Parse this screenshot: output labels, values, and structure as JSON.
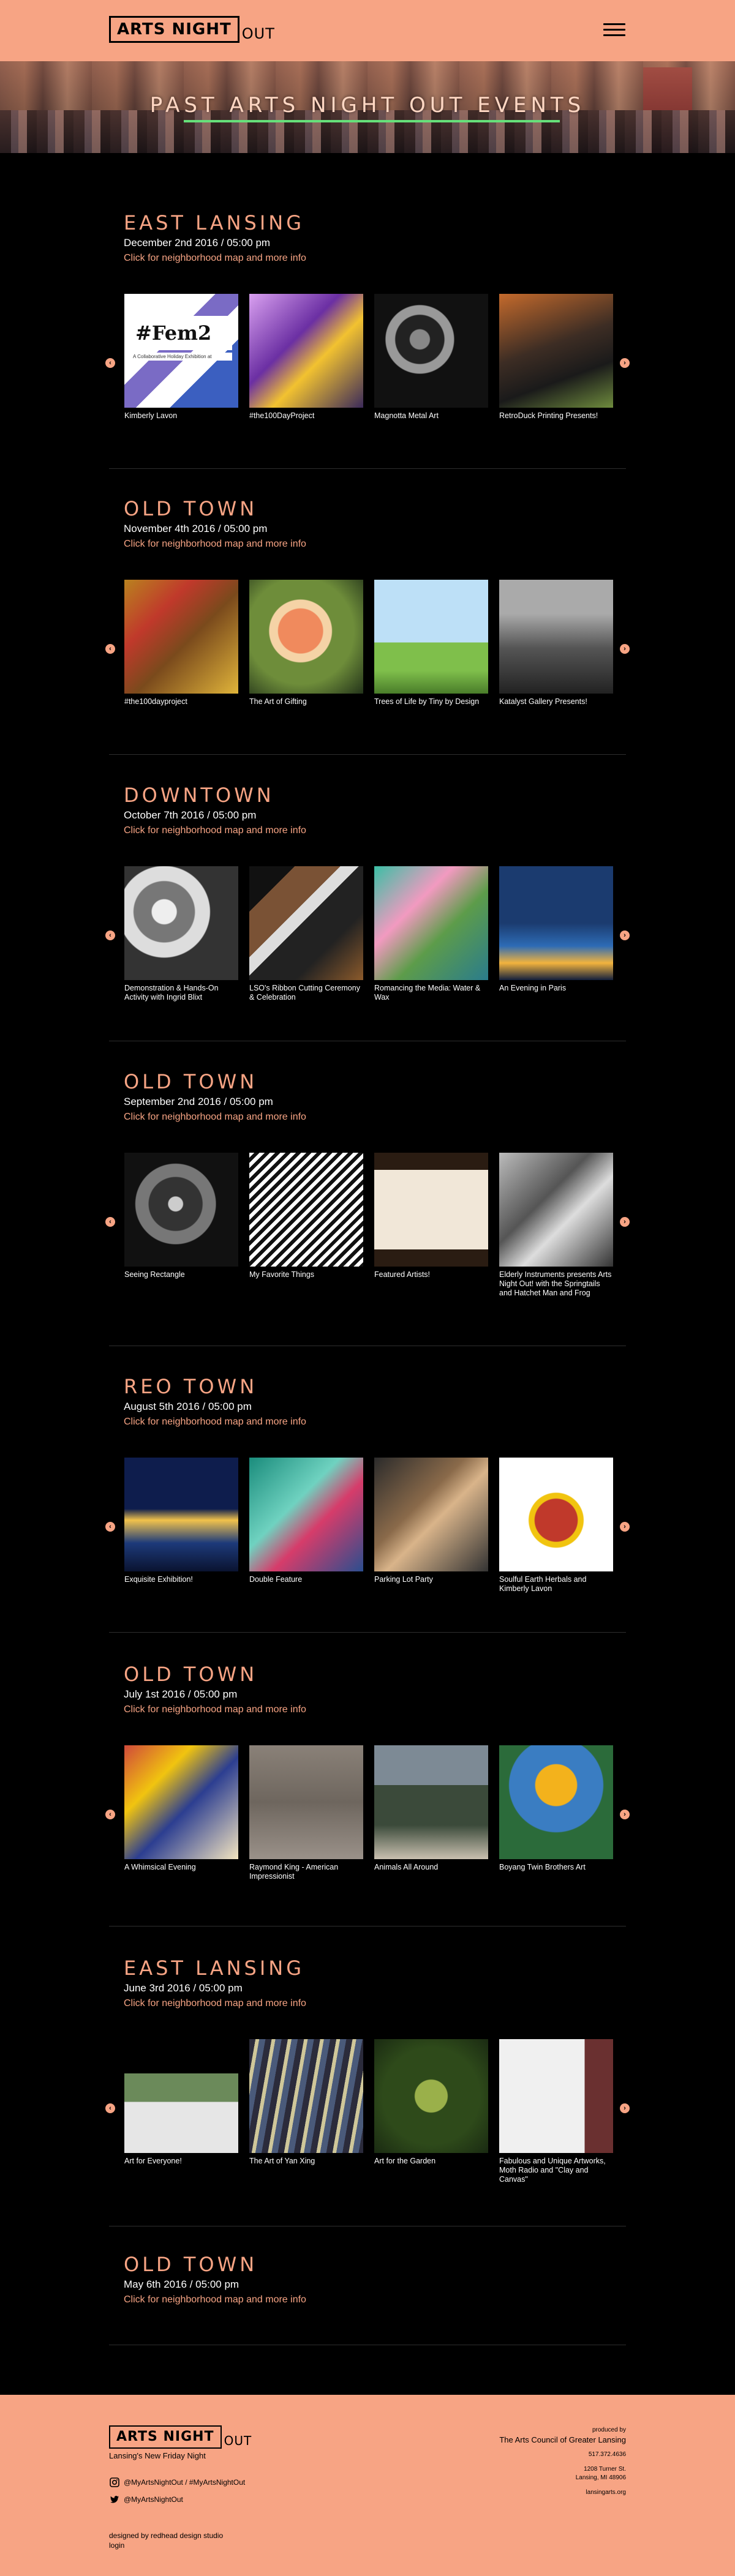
{
  "header": {
    "logo_main": "ARTS NIGHT",
    "logo_out": "OUT",
    "menu_icon": "hamburger-menu-icon"
  },
  "banner": {
    "title": "PAST ARTS NIGHT OUT EVENTS"
  },
  "events": [
    {
      "neighborhood": "EAST LANSING",
      "date": "December 2nd 2016 / 05:00 pm",
      "link": "Click for neighborhood map and more info",
      "items": [
        "Kimberly Lavon",
        "#the100DayProject",
        "Magnotta Metal Art",
        "RetroDuck Printing Presents!"
      ]
    },
    {
      "neighborhood": "OLD TOWN",
      "date": "November 4th 2016 / 05:00 pm",
      "link": "Click for neighborhood map and more info",
      "items": [
        "#the100dayproject",
        "The Art of Gifting",
        "Trees of Life by Tiny by Design",
        "Katalyst Gallery Presents!"
      ]
    },
    {
      "neighborhood": "DOWNTOWN",
      "date": "October 7th 2016 / 05:00 pm",
      "link": "Click for neighborhood map and more info",
      "items": [
        "Demonstration & Hands-On Activity with Ingrid Blixt",
        "LSO's Ribbon Cutting Ceremony & Celebration",
        "Romancing the Media: Water & Wax",
        "An Evening in Paris"
      ]
    },
    {
      "neighborhood": "OLD TOWN",
      "date": "September 2nd 2016 / 05:00 pm",
      "link": "Click for neighborhood map and more info",
      "items": [
        "Seeing Rectangle",
        "My Favorite Things",
        "Featured Artists!",
        "Elderly Instruments presents Arts Night Out! with the Springtails and Hatchet Man and Frog"
      ]
    },
    {
      "neighborhood": "REO TOWN",
      "date": "August 5th 2016 / 05:00 pm",
      "link": "Click for neighborhood map and more info",
      "items": [
        "Exquisite Exhibition!",
        "Double Feature",
        "Parking Lot Party",
        "Soulful Earth Herbals and Kimberly Lavon"
      ]
    },
    {
      "neighborhood": "OLD TOWN",
      "date": "July 1st 2016 / 05:00 pm",
      "link": "Click for neighborhood map and more info",
      "items": [
        "A Whimsical Evening",
        "Raymond King - American Impressionist",
        "Animals All Around",
        "Boyang Twin Brothers Art"
      ]
    },
    {
      "neighborhood": "EAST LANSING",
      "date": "June 3rd 2016 / 05:00 pm",
      "link": "Click for neighborhood map and more info",
      "items": [
        "Art for Everyone!",
        "The Art of Yan Xing",
        "Art for the Garden",
        "Fabulous and Unique Artworks, Moth Radio and \"Clay and Canvas\""
      ]
    },
    {
      "neighborhood": "OLD TOWN",
      "date": "May 6th 2016 / 05:00 pm",
      "link": "Click for neighborhood map and more info",
      "items": []
    }
  ],
  "arrows": {
    "prev": "‹",
    "next": "›"
  },
  "thumb_texts": {
    "fem2_title": "#Fem2",
    "fem2_sub": "A Collaborative Holiday Exhibition at"
  },
  "footer": {
    "logo_main": "ARTS NIGHT",
    "logo_out": "OUT",
    "tagline": "Lansing's New Friday Night",
    "instagram": "@MyArtsNightOut / #MyArtsNightOut",
    "twitter": "@MyArtsNightOut",
    "credit": "designed by redhead design studio",
    "login": "login",
    "produced_by": "produced by",
    "org": "The Arts Council of Greater Lansing",
    "phone": "517.372.4636",
    "address1": "1208 Turner St.",
    "address2": "Lansing, MI 48906",
    "website": "lansingarts.org"
  },
  "colors": {
    "accent": "#f7a484",
    "background": "#000000",
    "rule": "#2e2e2e",
    "banner_line": "#66e07a"
  }
}
